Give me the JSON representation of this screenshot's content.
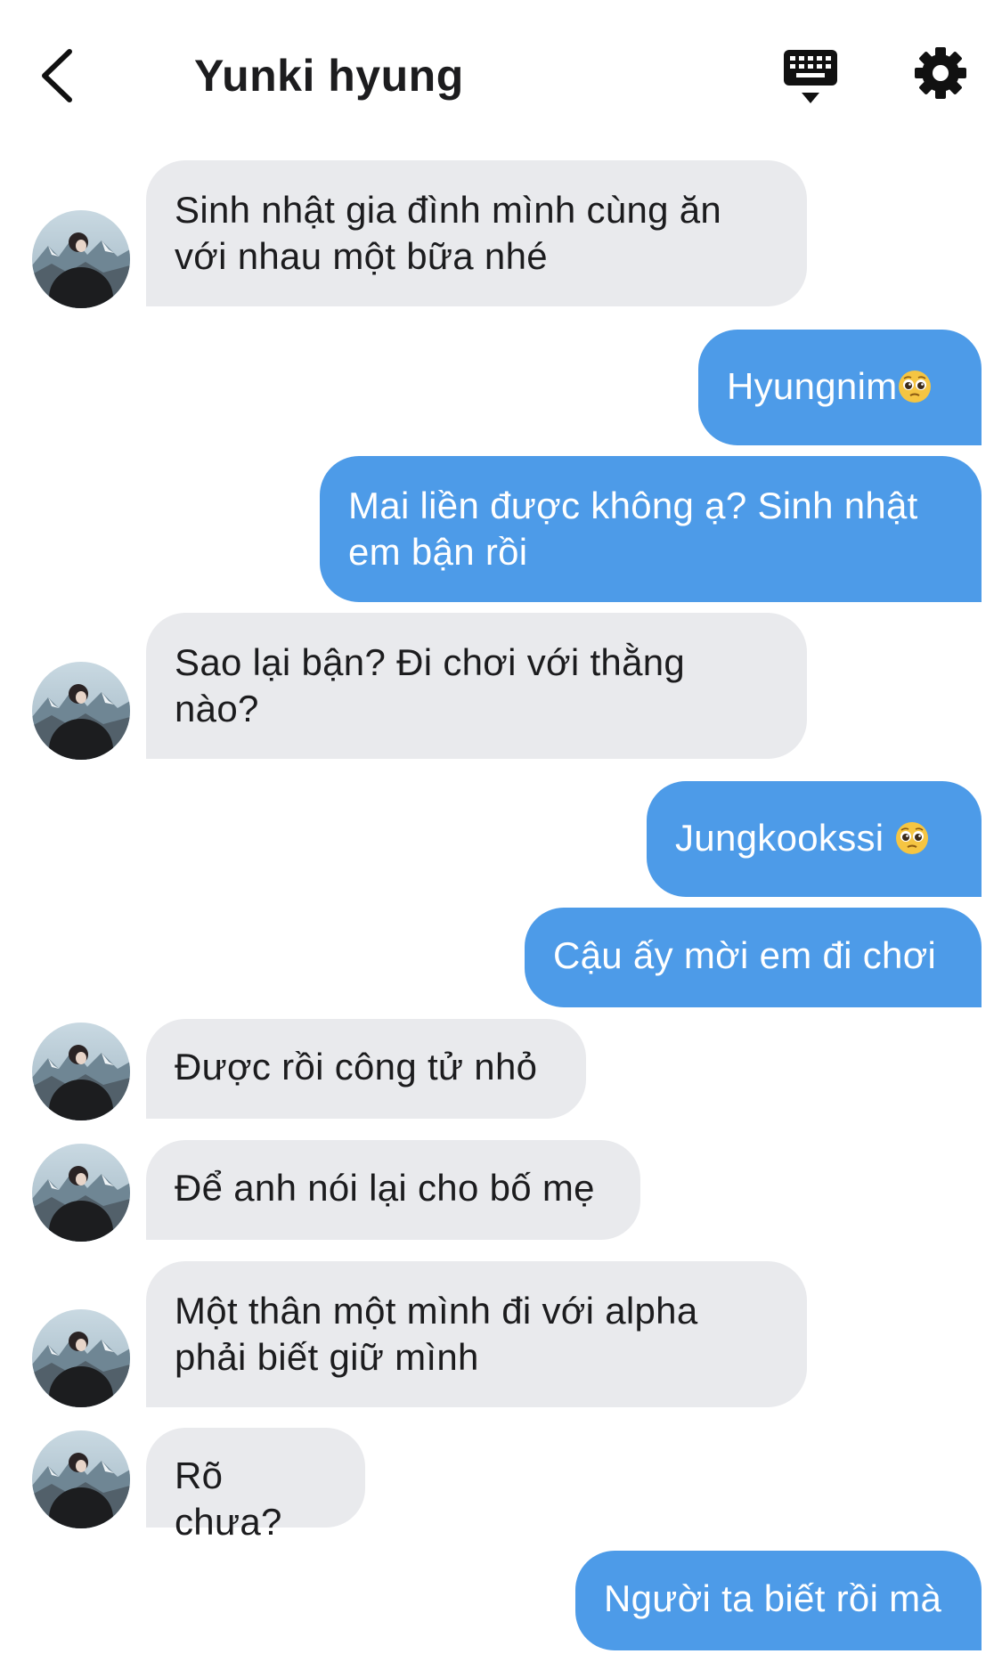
{
  "header": {
    "title": "Yunki hyung",
    "back_icon": "chevron-left-icon",
    "keyboard_icon": "keyboard-icon",
    "settings_icon": "gear-icon"
  },
  "colors": {
    "incoming_bubble": "#e9eaed",
    "outgoing_bubble": "#4d9be8",
    "title_text": "#1c1c1e"
  },
  "messages": [
    {
      "sender": "them",
      "text": "Sinh nhật gia đình mình cùng ăn với nhau một bữa nhé"
    },
    {
      "sender": "me",
      "text": "Hyungnim",
      "emoji": "pleading-face-emoji"
    },
    {
      "sender": "me",
      "text": "Mai liền được không ạ? Sinh nhật em bận rồi"
    },
    {
      "sender": "them",
      "text": "Sao lại bận? Đi chơi với thằng nào?"
    },
    {
      "sender": "me",
      "text": "Jungkookssi ",
      "emoji": "pleading-face-emoji"
    },
    {
      "sender": "me",
      "text": "Cậu ấy mời em đi chơi"
    },
    {
      "sender": "them",
      "text": "Được rồi công tử nhỏ"
    },
    {
      "sender": "them",
      "text": "Để anh nói lại cho bố mẹ"
    },
    {
      "sender": "them",
      "text": "Một thân một mình đi với alpha phải biết giữ mình"
    },
    {
      "sender": "them",
      "text": "Rõ chưa?"
    },
    {
      "sender": "me",
      "text": "Người ta biết rồi mà"
    }
  ]
}
